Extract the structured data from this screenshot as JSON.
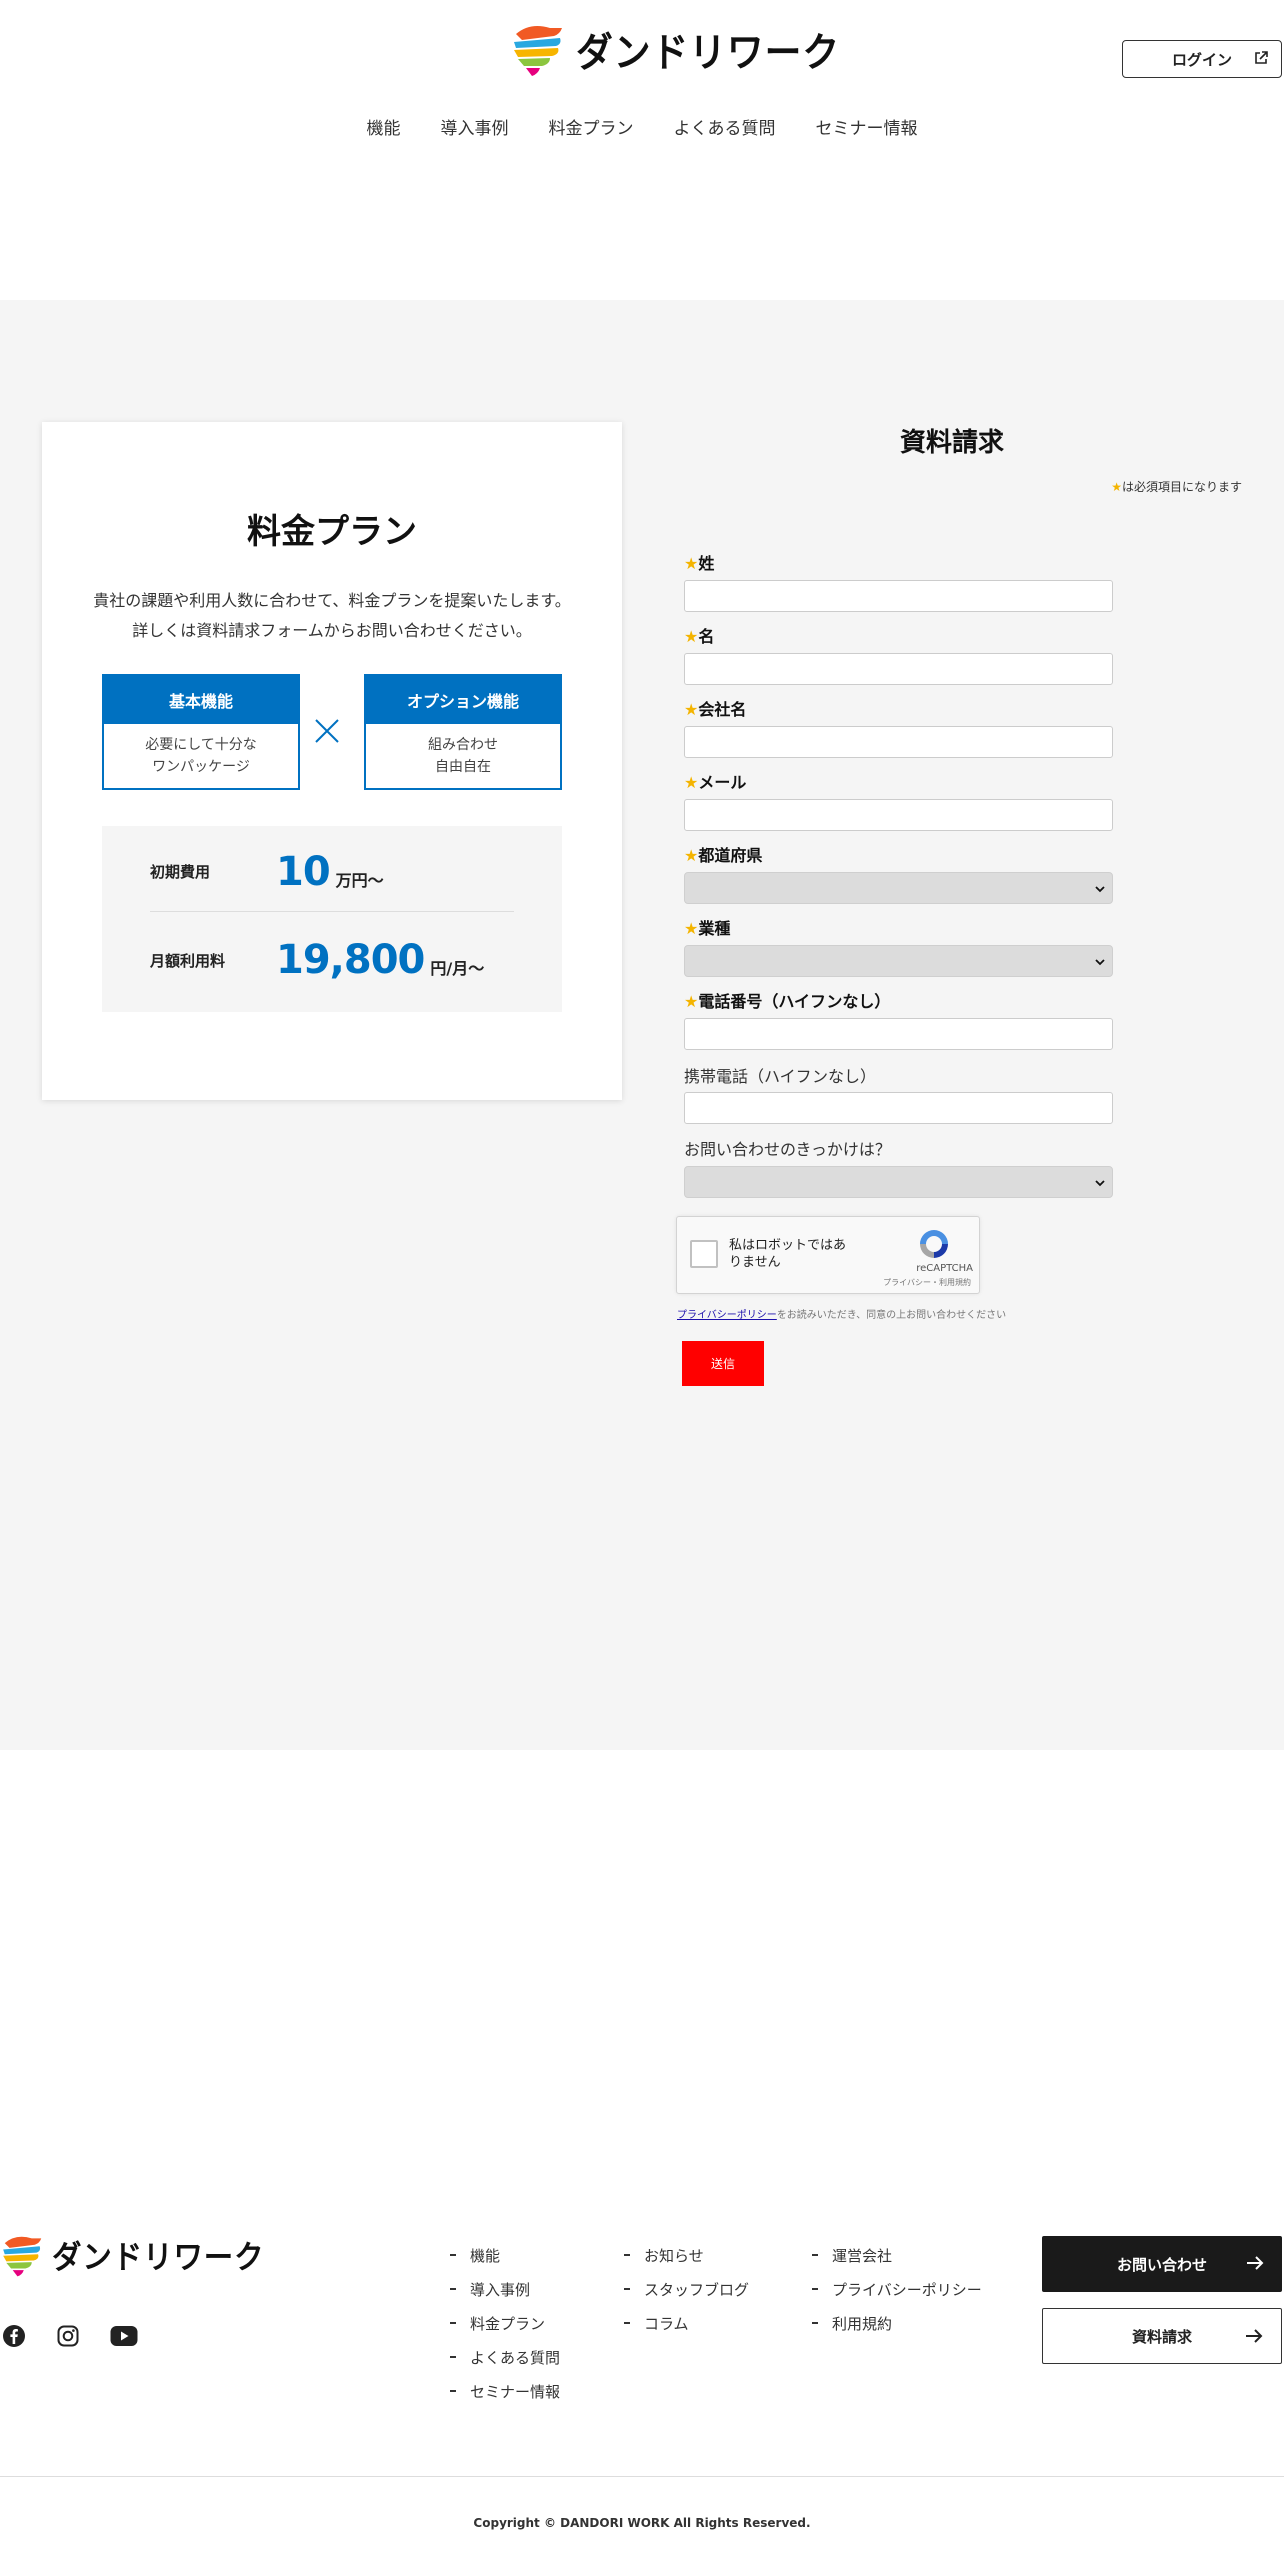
{
  "header": {
    "logo_text": "ダンドリワーク",
    "login_label": "ログイン",
    "nav": [
      "機能",
      "導入事例",
      "料金プラン",
      "よくある質問",
      "セミナー情報"
    ]
  },
  "pricing": {
    "title": "料金プラン",
    "desc_line1": "貴社の課題や利用人数に合わせて、料金プランを提案いたします。",
    "desc_line2": "詳しくは資料請求フォームからお問い合わせください。",
    "basic": {
      "title": "基本機能",
      "line1": "必要にして十分な",
      "line2": "ワンパッケージ"
    },
    "option": {
      "title": "オプション機能",
      "line1": "組み合わせ",
      "line2": "自由自在"
    },
    "initial": {
      "label": "初期費用",
      "value": "10",
      "unit": "万円〜"
    },
    "monthly": {
      "label": "月額利用料",
      "value": "19,800",
      "unit": "円/月〜"
    }
  },
  "form": {
    "title": "資料請求",
    "required_star": "★",
    "required_note": "は必須項目になります",
    "fields": {
      "last_name": "姓",
      "first_name": "名",
      "company": "会社名",
      "email": "メール",
      "prefecture": "都道府県",
      "industry": "業種",
      "phone": "電話番号（ハイフンなし）",
      "mobile": "携帯電話（ハイフンなし）",
      "trigger": "お問い合わせのきっかけは？"
    },
    "recaptcha": {
      "label": "私はロボットではありません",
      "brand": "reCAPTCHA",
      "links": "プライバシー・利用規約"
    },
    "privacy_link": "プライバシーポリシー",
    "privacy_text": "をお読みいただき、同意の上お問い合わせください",
    "submit_label": "送信"
  },
  "footer": {
    "logo_text": "ダンドリワーク",
    "col1": [
      "機能",
      "導入事例",
      "料金プラン",
      "よくある質問",
      "セミナー情報"
    ],
    "col2": [
      "お知らせ",
      "スタッフブログ",
      "コラム"
    ],
    "col3": [
      "運営会社",
      "プライバシーポリシー",
      "利用規約"
    ],
    "contact_label": "お問い合わせ",
    "docs_label": "資料請求",
    "copyright": "Copyright © DANDORI WORK All Rights Reserved."
  },
  "colors": {
    "accent_blue": "#0071c1",
    "submit_red": "#ff0000",
    "required_star": "#f4b400",
    "section_bg": "#f5f5f5",
    "footer_button_dark": "#1a1a1a"
  },
  "icons": [
    "logo-mark-icon",
    "external-link-icon",
    "times-icon",
    "chevron-down-icon",
    "recaptcha-logo-icon",
    "facebook-icon",
    "instagram-icon",
    "youtube-icon",
    "arrow-right-icon"
  ]
}
